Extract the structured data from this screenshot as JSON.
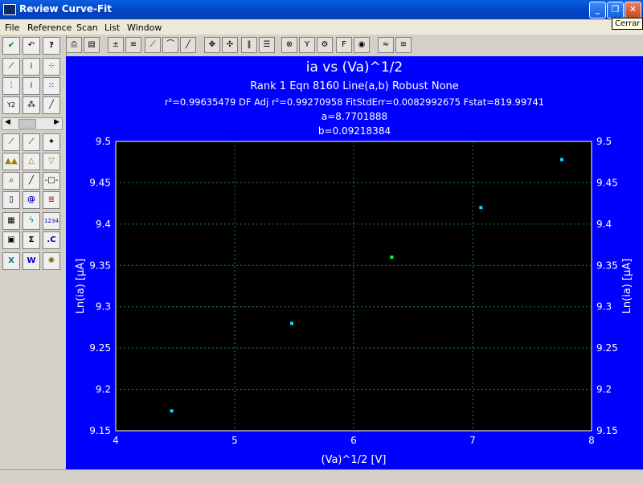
{
  "window": {
    "title": "Review Curve-Fit",
    "tooltip": "Cerrar"
  },
  "menu": [
    "File",
    "Reference",
    "Scan",
    "List",
    "Window"
  ],
  "toolbar_icons": [
    "print-icon",
    "copy-icon",
    "add-point-icon",
    "remove-point-icon",
    "line-fit-icon",
    "curve-fit-icon",
    "curve2-fit-icon",
    "zoom-icon",
    "pan-icon",
    "bars-icon",
    "list-icon",
    "binoculars-icon",
    "filter-icon",
    "settings-icon",
    "font-icon",
    "color-icon",
    "wave-icon",
    "wave2-icon"
  ],
  "left_icons": [
    "check-icon",
    "undo-icon",
    "help-icon",
    "chart-icon",
    "chart2-icon",
    "chart3-icon",
    "chart4-icon",
    "chart5-icon",
    "chart6-icon",
    "y2-icon",
    "chart7-icon",
    "line-icon",
    "fit-icon",
    "fit2-icon",
    "sparkle-icon",
    "triangle-up-icon",
    "triangle-icon",
    "triangle-down-icon",
    "zoom-page-icon",
    "slash-icon",
    "dots-icon",
    "page-icon",
    "at-icon",
    "pattern-icon",
    "grid-icon",
    "bolt-icon",
    "numbers-icon",
    "clipboard-icon",
    "sigma-icon",
    "c-icon",
    "x-icon",
    "w-icon",
    "gear-icon"
  ],
  "plot": {
    "title": "ia vs (Va)^1/2",
    "line1": "Rank 1  Eqn 8160  Line(a,b) Robust None",
    "line2": "r²=0.99635479  DF Adj r²=0.99270958  FitStdErr=0.0082992675  Fstat=819.99741",
    "line3": "a=8.7701888",
    "line4": "b=0.09218384"
  },
  "chart_data": {
    "type": "scatter",
    "title": "ia vs (Va)^1/2",
    "xlabel": "(Va)^1/2 [V]",
    "ylabel": "Ln(ia) [µA]",
    "xlim": [
      4,
      8
    ],
    "ylim": [
      9.15,
      9.5
    ],
    "x_ticks": [
      "4",
      "5",
      "6",
      "7",
      "8"
    ],
    "y_ticks": [
      "9.15",
      "9.2",
      "9.25",
      "9.3",
      "9.35",
      "9.4",
      "9.45",
      "9.5"
    ],
    "points": [
      {
        "x": 4.47,
        "y": 9.174,
        "color": "#00e0ff"
      },
      {
        "x": 5.48,
        "y": 9.28,
        "color": "#00e0ff"
      },
      {
        "x": 6.32,
        "y": 9.36,
        "color": "#00ff40"
      },
      {
        "x": 7.07,
        "y": 9.42,
        "color": "#00e0ff"
      },
      {
        "x": 7.75,
        "y": 9.478,
        "color": "#00e0ff"
      }
    ],
    "fit": {
      "a": 8.7701888,
      "b": 0.09218384,
      "color": "#ffffff"
    },
    "grid": true
  }
}
